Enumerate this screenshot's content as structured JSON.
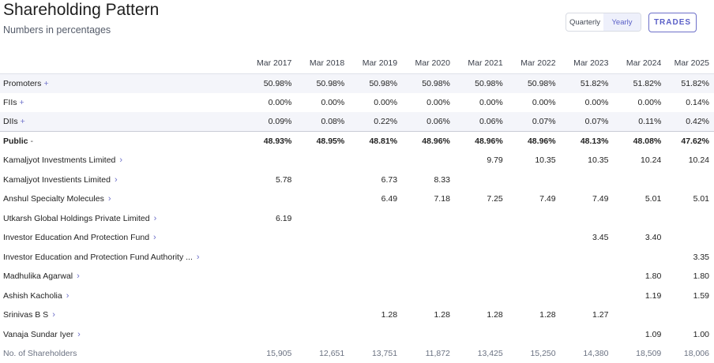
{
  "header": {
    "title": "Shareholding Pattern",
    "subtitle": "Numbers in percentages",
    "period_toggle": [
      "Quarterly",
      "Yearly"
    ],
    "active_period": "Yearly",
    "trades_label": "TRADES"
  },
  "table": {
    "columns": [
      "Mar 2017",
      "Mar 2018",
      "Mar 2019",
      "Mar 2020",
      "Mar 2021",
      "Mar 2022",
      "Mar 2023",
      "Mar 2024",
      "Mar 2025"
    ],
    "rows": [
      {
        "label": "Promoters",
        "marker": "+",
        "style": "shade",
        "values": [
          "50.98%",
          "50.98%",
          "50.98%",
          "50.98%",
          "50.98%",
          "50.98%",
          "51.82%",
          "51.82%",
          "51.82%"
        ]
      },
      {
        "label": "FIIs",
        "marker": "+",
        "style": "plain",
        "values": [
          "0.00%",
          "0.00%",
          "0.00%",
          "0.00%",
          "0.00%",
          "0.00%",
          "0.00%",
          "0.00%",
          "0.14%"
        ]
      },
      {
        "label": "DIIs",
        "marker": "+",
        "style": "shade",
        "values": [
          "0.09%",
          "0.08%",
          "0.22%",
          "0.06%",
          "0.06%",
          "0.07%",
          "0.07%",
          "0.11%",
          "0.42%"
        ]
      },
      {
        "label": "Public",
        "marker": "-",
        "style": "public",
        "values": [
          "48.93%",
          "48.95%",
          "48.81%",
          "48.96%",
          "48.96%",
          "48.96%",
          "48.13%",
          "48.08%",
          "47.62%"
        ]
      },
      {
        "label": "Kamaljyot Investments Limited",
        "marker": "chev",
        "style": "plain",
        "values": [
          "",
          "",
          "",
          "",
          "9.79",
          "10.35",
          "10.35",
          "10.24",
          "10.24"
        ]
      },
      {
        "label": "Kamaljyot Investients Limited",
        "marker": "chev",
        "style": "plain",
        "values": [
          "5.78",
          "",
          "6.73",
          "8.33",
          "",
          "",
          "",
          "",
          ""
        ]
      },
      {
        "label": "Anshul Specialty Molecules",
        "marker": "chev",
        "style": "plain",
        "values": [
          "",
          "",
          "6.49",
          "7.18",
          "7.25",
          "7.49",
          "7.49",
          "5.01",
          "5.01"
        ]
      },
      {
        "label": "Utkarsh Global Holdings Private Limited",
        "marker": "chev",
        "style": "plain",
        "values": [
          "6.19",
          "",
          "",
          "",
          "",
          "",
          "",
          "",
          ""
        ]
      },
      {
        "label": "Investor Education And Protection Fund",
        "marker": "chev",
        "style": "plain",
        "values": [
          "",
          "",
          "",
          "",
          "",
          "",
          "3.45",
          "3.40",
          ""
        ]
      },
      {
        "label": "Investor Education and Protection Fund Authority ...",
        "marker": "chev",
        "style": "plain",
        "values": [
          "",
          "",
          "",
          "",
          "",
          "",
          "",
          "",
          "3.35"
        ]
      },
      {
        "label": "Madhulika Agarwal",
        "marker": "chev",
        "style": "plain",
        "values": [
          "",
          "",
          "",
          "",
          "",
          "",
          "",
          "1.80",
          "1.80"
        ]
      },
      {
        "label": "Ashish Kacholia",
        "marker": "chev",
        "style": "plain",
        "values": [
          "",
          "",
          "",
          "",
          "",
          "",
          "",
          "1.19",
          "1.59"
        ]
      },
      {
        "label": "Srinivas B S",
        "marker": "chev",
        "style": "plain",
        "values": [
          "",
          "",
          "1.28",
          "1.28",
          "1.28",
          "1.28",
          "1.27",
          "",
          ""
        ]
      },
      {
        "label": "Vanaja Sundar Iyer",
        "marker": "chev",
        "style": "plain",
        "values": [
          "",
          "",
          "",
          "",
          "",
          "",
          "",
          "1.09",
          "1.00"
        ]
      },
      {
        "label": "No. of Shareholders",
        "marker": "",
        "style": "footer",
        "values": [
          "15,905",
          "12,651",
          "13,751",
          "11,872",
          "13,425",
          "15,250",
          "14,380",
          "18,509",
          "18,006"
        ]
      }
    ]
  }
}
